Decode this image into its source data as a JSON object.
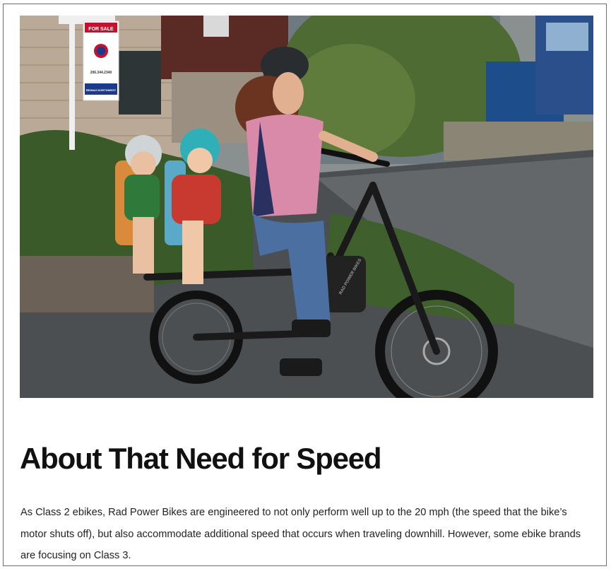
{
  "article": {
    "hero_image": {
      "alt": "Mother riding a black cargo e-bike with two children in helmets on rear seats",
      "sign": {
        "header": "FOR SALE",
        "phone": "206.344.2340",
        "brokerage": "RE/MAX NORTHWEST"
      },
      "bike_frame_text": "RAD POWER BIKES"
    },
    "heading": "About That Need for Speed",
    "paragraph": "As Class 2 ebikes, Rad Power Bikes are engineered to not only perform well up to the 20 mph (the speed that the bike’s motor shuts off), but also accommodate additional speed that occurs when traveling downhill. However, some ebike brands are focusing on Class 3."
  },
  "colors": {
    "text": "#111111",
    "sign_red": "#c8102e",
    "sign_blue": "#1b3a8a"
  }
}
